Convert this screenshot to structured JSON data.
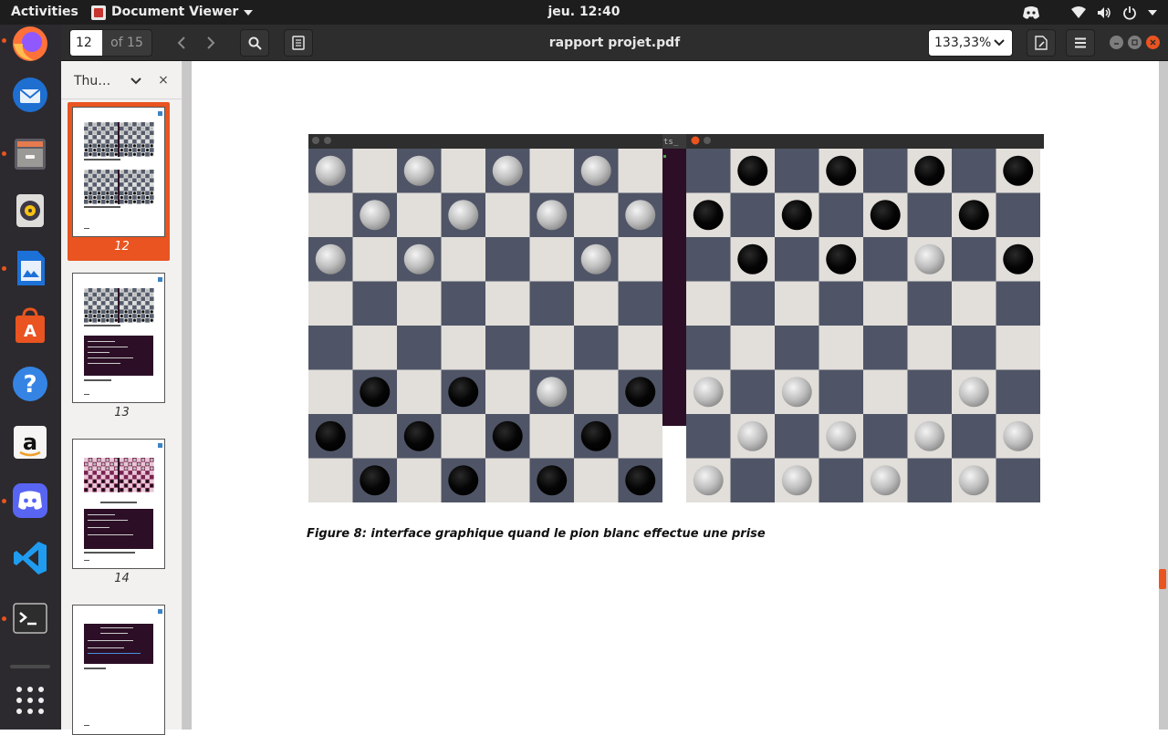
{
  "topbar": {
    "activities": "Activities",
    "app_name": "Document Viewer",
    "clock": "jeu. 12:40"
  },
  "dock": {
    "items": [
      {
        "name": "firefox-icon",
        "running": true
      },
      {
        "name": "thunderbird-icon",
        "running": false
      },
      {
        "name": "files-icon",
        "running": true
      },
      {
        "name": "rhythmbox-icon",
        "running": false
      },
      {
        "name": "libreoffice-writer-icon",
        "running": true
      },
      {
        "name": "ubuntu-software-icon",
        "running": false
      },
      {
        "name": "help-icon",
        "running": false
      },
      {
        "name": "amazon-icon",
        "running": false
      },
      {
        "name": "discord-icon",
        "running": true
      },
      {
        "name": "vscode-icon",
        "running": false
      },
      {
        "name": "terminal-icon",
        "running": true
      },
      {
        "name": "show-apps-icon",
        "running": false
      }
    ]
  },
  "header": {
    "page_value": "12",
    "page_of": "of 15",
    "title": "rapport projet.pdf",
    "zoom": "133,33%"
  },
  "sidebar": {
    "mode_label": "Thu…",
    "close_label": "×",
    "thumbs": [
      {
        "label": "12",
        "selected": true
      },
      {
        "label": "13",
        "selected": false
      },
      {
        "label": "14",
        "selected": false
      },
      {
        "label": "",
        "selected": false
      }
    ]
  },
  "figure": {
    "caption": "Figure 8: interface graphique quand le pion blanc effectue une prise",
    "left_board": [
      "W.W.W.W.",
      ".W.W.W.W",
      "W.W...W.",
      "........",
      "........",
      ".B.B.W.B",
      "B.B.B.B.",
      ".B.B.B.B"
    ],
    "right_board": [
      ".B.B.B.B",
      "B.B.B.B.",
      ".B.B.W.B",
      "........",
      "........",
      "W.W...W.",
      ".W.W.W.W",
      "W.W.W.W."
    ],
    "terminal_fragment": "ts_",
    "colors": {
      "light_square": "#e2deda",
      "dark_square": "#4f5566",
      "terminal_purple": "#2c0f26",
      "accent": "#e95420"
    }
  }
}
